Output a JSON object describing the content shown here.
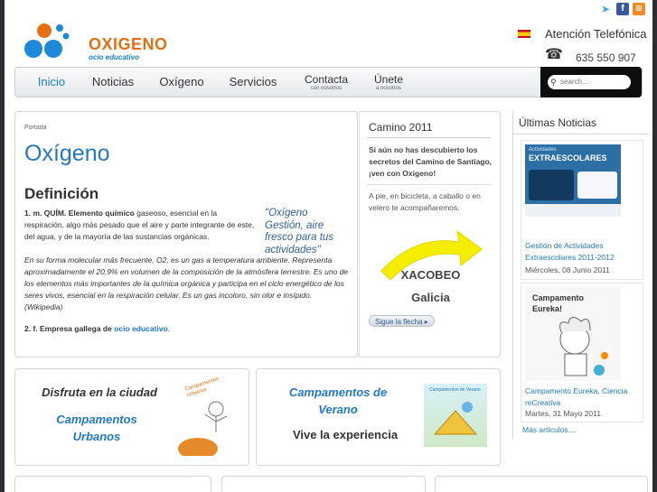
{
  "brand": {
    "name": "OXIGENO",
    "tagline": "ocio educativo",
    "orange": "#e56f12",
    "blue": "#1c7bc6"
  },
  "header": {
    "social": [
      "twitter-icon",
      "facebook-icon",
      "rss-icon"
    ],
    "attention_label": "Atención Telefónica",
    "phone": "635 550 907"
  },
  "nav": {
    "items": [
      {
        "label": "Inicio",
        "sub": ""
      },
      {
        "label": "Noticias",
        "sub": ""
      },
      {
        "label": "Oxígeno",
        "sub": ""
      },
      {
        "label": "Servicios",
        "sub": ""
      },
      {
        "label": "Contacta",
        "sub": "con nosotros"
      },
      {
        "label": "Únete",
        "sub": "a nosotros"
      }
    ],
    "search_placeholder": "search..."
  },
  "main": {
    "breadcrumb": "Portada",
    "title": "Oxígeno",
    "subtitle": "Definición",
    "def1_bold": "1. m. QUÍM. Elemento químico",
    "def1_text": " gaseoso, esencial en la respiración, algo más pesado que el aire y parte integrante de este, del agua, y de la mayoría de las sustancias orgánicas.",
    "quote": "\"Oxígeno Gestión, aire fresco para tus actividades\"",
    "def_italic": "En su forma molecular más frecuente, O2, es un gas a temperatura ambiente. Representa aproximadamente el 20,9% en volumen de la composición de la atmósfera terrestre. Es uno de los elementos más importantes de la química orgánica y participa en el ciclo energético de los seres vivos, esencial en la respiración celular. Es un gas incoloro, sin olor e insípido. (Wikipedia)",
    "def2_bold": "2. f. Empresa gallega de",
    "def2_link": "ocio educativo",
    "def2_end": "."
  },
  "camino": {
    "title": "Camino 2011",
    "bold_text": "Si aún no has descubierto los secretos del Camino de Santiago, ¡ven con Oxigeno!",
    "text": "A pie, en bicicleta, a caballo o en velero te acompañaremos.",
    "line1": "XACOBEO",
    "line2": "Galicia",
    "button": "Sigue la flecha"
  },
  "news": {
    "title": "Últimas Noticias",
    "items": [
      {
        "link": "Gestión de Actividades Extraescolares 2011-2012",
        "date": "Miércoles, 08 Junio 2011",
        "image_heading": "EXTRAESCOLARES",
        "image_top": "Actividades"
      },
      {
        "link": "Campamento Eureka, Ciencia reCreativa",
        "date": "Martes, 31 Mayo 2011",
        "image_heading": "Campamento Eureka!"
      }
    ],
    "more": "Más artículos...."
  },
  "promos": {
    "left_heading": "Disfruta en la ciudad",
    "left_link": "Campamentos Urbanos",
    "left_image_text": "Campamentos Urbanos",
    "right_link": "Campamentos de Verano",
    "right_sub": "Vive la experiencia",
    "right_image_text": "Campamentos de Verano"
  }
}
